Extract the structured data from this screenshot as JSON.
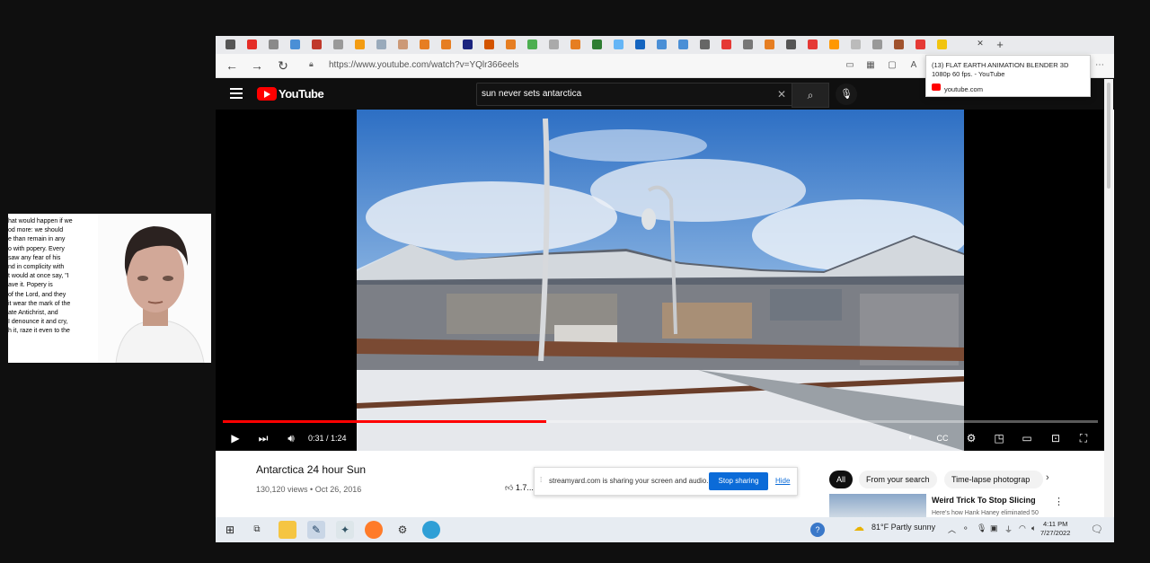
{
  "webcam": {
    "overlay_text_lines": [
      "hat would happen if we",
      "od more: we should",
      "e than remain in any",
      "o with popery. Every",
      " saw any fear of his",
      "nd in complicity with",
      "t would at once say, \"I",
      "ave it. Popery is",
      " of the Lord, and they",
      " it wear the mark of the",
      "ate Antichrist, and",
      " I denounce it and cry,",
      "h it, raze it even to the"
    ]
  },
  "browser": {
    "url": "https://www.youtube.com/watch?v=YQlr366eels",
    "tab_close": "✕",
    "new_tab": "+",
    "tab_colors": [
      "#555",
      "#e52d27",
      "#8a8a8a",
      "#4a8fd6",
      "#c0392b",
      "#999",
      "#f39c12",
      "#9ab",
      "#c97",
      "#e67e22",
      "#e67e22",
      "#1a237e",
      "#d35400",
      "#e67e22",
      "#4caf50",
      "#aaa",
      "#e67e22",
      "#2e7d32",
      "#64b5f6",
      "#1565c0",
      "#4a8fd6",
      "#4a8fd6",
      "#666",
      "#e53935",
      "#777",
      "#e67e22",
      "#555",
      "#e53935",
      "#ff9800",
      "#bbb",
      "#999",
      "#a0522d",
      "#e53935",
      "#f1c40f"
    ]
  },
  "youtube": {
    "logo_text": "YouTube",
    "search_value": "sun never sets antarctica",
    "player": {
      "current_time": "0:31",
      "duration": "1:24",
      "time_display": "0:31 / 1:24",
      "progress_fraction": 0.37
    },
    "video": {
      "title": "Antarctica 24 hour Sun",
      "meta": "130,120 views • Oct 26, 2016",
      "likes": "1.7..."
    },
    "chips": [
      "All",
      "From your search",
      "Time-lapse photograp"
    ],
    "recommendation": {
      "title": "Weird Trick To Stop Slicing",
      "subtitle": "Here's how Hank Haney eliminated 50"
    }
  },
  "share_notification": {
    "text": "streamyard.com is sharing your screen and audio.",
    "stop_label": "Stop sharing",
    "hide_label": "Hide"
  },
  "tab_tooltip": {
    "title": "(13) FLAT EARTH ANIMATION BLENDER 3D",
    "subtitle": "1080p 60 fps. - YouTube",
    "host": "youtube.com"
  },
  "taskbar": {
    "weather": "81°F  Partly sunny",
    "time": "4:11 PM",
    "date": "7/27/2022"
  }
}
